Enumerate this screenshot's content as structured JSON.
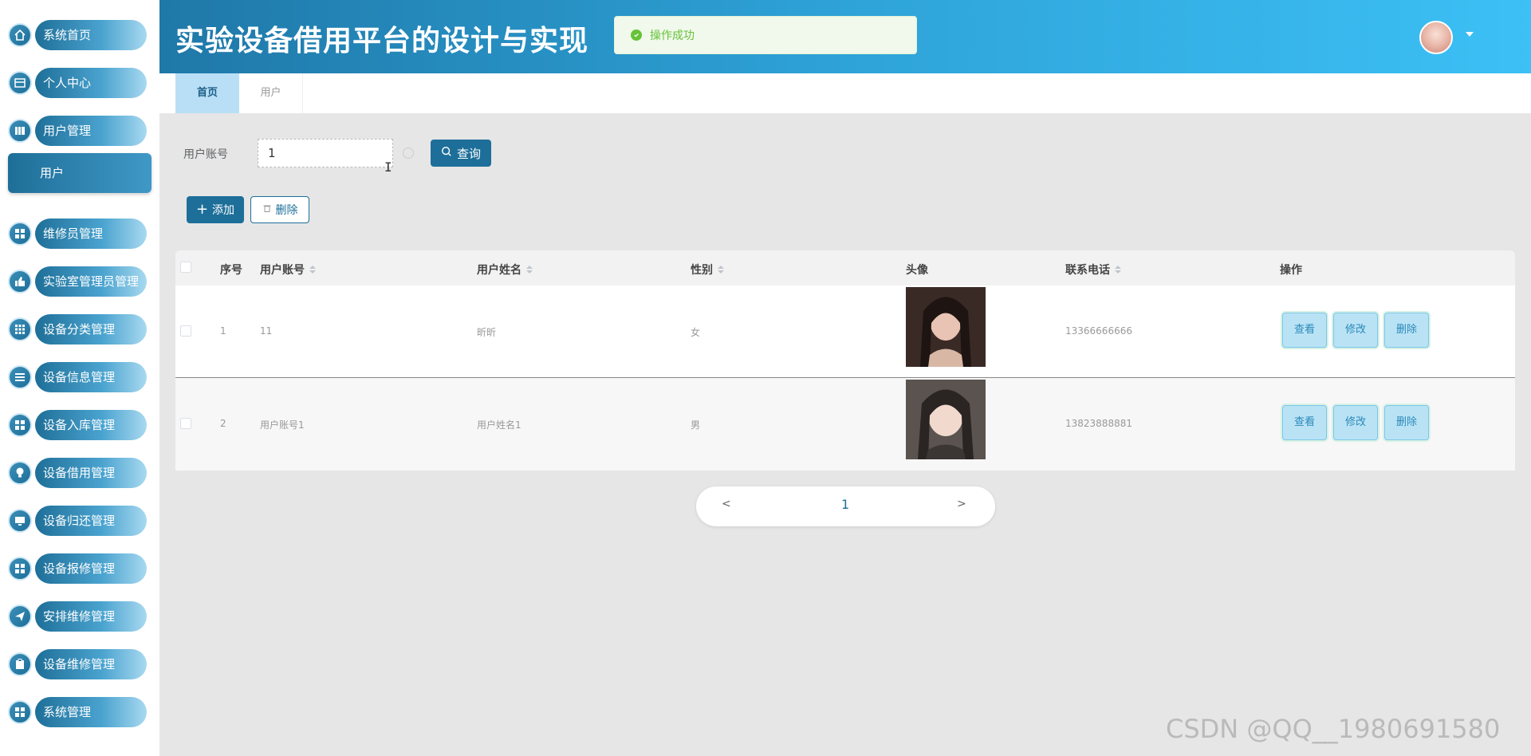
{
  "sidebar": {
    "items": [
      {
        "label": "系统首页",
        "icon": "home-icon"
      },
      {
        "label": "个人中心",
        "icon": "card-icon"
      },
      {
        "label": "用户管理",
        "icon": "library-icon"
      },
      {
        "label": "维修员管理",
        "icon": "grid-icon"
      },
      {
        "label": "实验室管理员管理",
        "icon": "thumb-icon"
      },
      {
        "label": "设备分类管理",
        "icon": "grid-icon"
      },
      {
        "label": "设备信息管理",
        "icon": "list-icon"
      },
      {
        "label": "设备入库管理",
        "icon": "grid-icon"
      },
      {
        "label": "设备借用管理",
        "icon": "bulb-icon"
      },
      {
        "label": "设备归还管理",
        "icon": "monitor-icon"
      },
      {
        "label": "设备报修管理",
        "icon": "grid-icon"
      },
      {
        "label": "安排维修管理",
        "icon": "send-icon"
      },
      {
        "label": "设备维修管理",
        "icon": "clipboard-icon"
      },
      {
        "label": "系统管理",
        "icon": "grid-icon"
      }
    ],
    "sub_item": "用户"
  },
  "header": {
    "title": "实验设备借用平台的设计与实现",
    "toast": "操作成功"
  },
  "tabs": [
    {
      "label": "首页"
    },
    {
      "label": "用户"
    }
  ],
  "search": {
    "label": "用户账号",
    "value": "1",
    "button": "查询"
  },
  "actions": {
    "add": "添加",
    "delete": "删除"
  },
  "table": {
    "headers": [
      "序号",
      "用户账号",
      "用户姓名",
      "性别",
      "头像",
      "联系电话",
      "操作"
    ],
    "rows": [
      {
        "index": "1",
        "account": "11",
        "name": "昕昕",
        "gender": "女",
        "phone": "13366666666"
      },
      {
        "index": "2",
        "account": "用户账号1",
        "name": "用户姓名1",
        "gender": "男",
        "phone": "13823888881"
      }
    ],
    "ops": {
      "view": "查看",
      "edit": "修改",
      "delete": "删除"
    }
  },
  "pagination": {
    "prev": "<",
    "current": "1",
    "next": ">"
  },
  "watermark": "CSDN @QQ__1980691580",
  "colors": {
    "primary": "#1d6f99",
    "header_start": "#1f78a8",
    "header_end": "#3cc0f5",
    "success": "#67c23a"
  }
}
